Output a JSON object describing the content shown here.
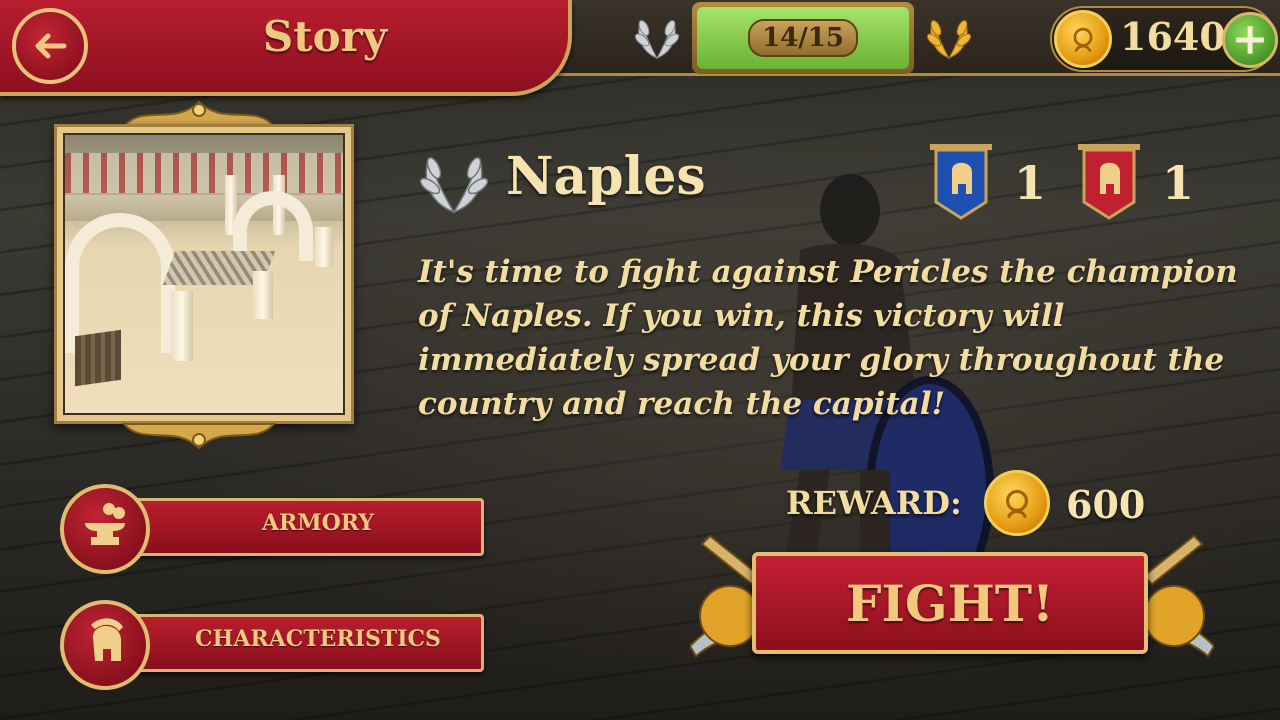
{
  "header": {
    "title": "Story",
    "progress_current": "14",
    "progress_separator": "/",
    "progress_total": "15",
    "coins": "1640",
    "plus_symbol": "+"
  },
  "level": {
    "name": "Naples",
    "ally_count": "1",
    "enemy_count": "1",
    "description": "It's time to fight against Pericles the champion of Naples. If you win, this victory will immediately spread your glory throughout the country and reach the capital!",
    "reward_label": "REWARD:",
    "reward_value": "600"
  },
  "side_menu": {
    "armory_label": "ARMORY",
    "characteristics_label": "CHARACTERISTICS"
  },
  "fight_label": "FIGHT!",
  "icons": {
    "back": "back-arrow-icon",
    "silver_laurel": "silver-laurel-icon",
    "gold_laurel": "gold-laurel-icon",
    "coin": "gold-coin-icon",
    "plus": "plus-icon",
    "anvil": "anvil-icon",
    "helmet": "helmet-icon",
    "blue_banner": "blue-helmet-banner-icon",
    "red_banner": "red-helmet-banner-icon",
    "crossed_swords": "crossed-swords-icon"
  },
  "colors": {
    "crimson": "#b81e2e",
    "gold": "#e3bf74",
    "text_gold": "#f3dca0",
    "green": "#8fd85a"
  }
}
